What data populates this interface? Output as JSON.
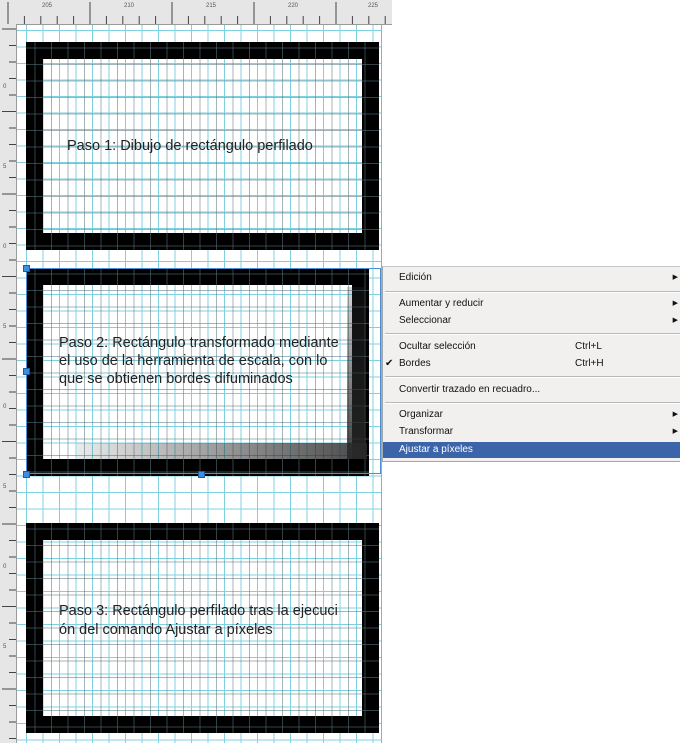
{
  "ruler": {
    "top_labels": [
      "205",
      "210",
      "215",
      "220",
      "225"
    ],
    "left_labels": [
      "0",
      "5",
      "0",
      "5",
      "0",
      "5",
      "0",
      "5"
    ]
  },
  "steps": {
    "step1": "Paso 1: Dibujo de rectángulo perfilado",
    "step2_lines": [
      "Paso 2: Rectángulo transformado mediante",
      "el uso de la herramienta de escala, con lo",
      "que se obtienen bordes difuminados"
    ],
    "step3_lines": [
      "Paso 3: Rectángulo perfilado tras la ejecuci",
      "ón del comando Ajustar a píxeles"
    ]
  },
  "context_menu": {
    "edit": "Edición",
    "zoom": "Aumentar y reducir",
    "select": "Seleccionar",
    "hide_selection": "Ocultar selección",
    "hide_selection_shortcut": "Ctrl+L",
    "edges": "Bordes",
    "edges_shortcut": "Ctrl+H",
    "convert_path": "Convertir trazado en recuadro...",
    "arrange": "Organizar",
    "transform": "Transformar",
    "snap_pixels": "Ajustar a píxeles",
    "submenu_arrow": "▶",
    "check_mark": "✔"
  },
  "colors": {
    "grid": "#7fd0e0",
    "highlight": "#3c64a8",
    "menu_bg": "#f1f0ee"
  }
}
